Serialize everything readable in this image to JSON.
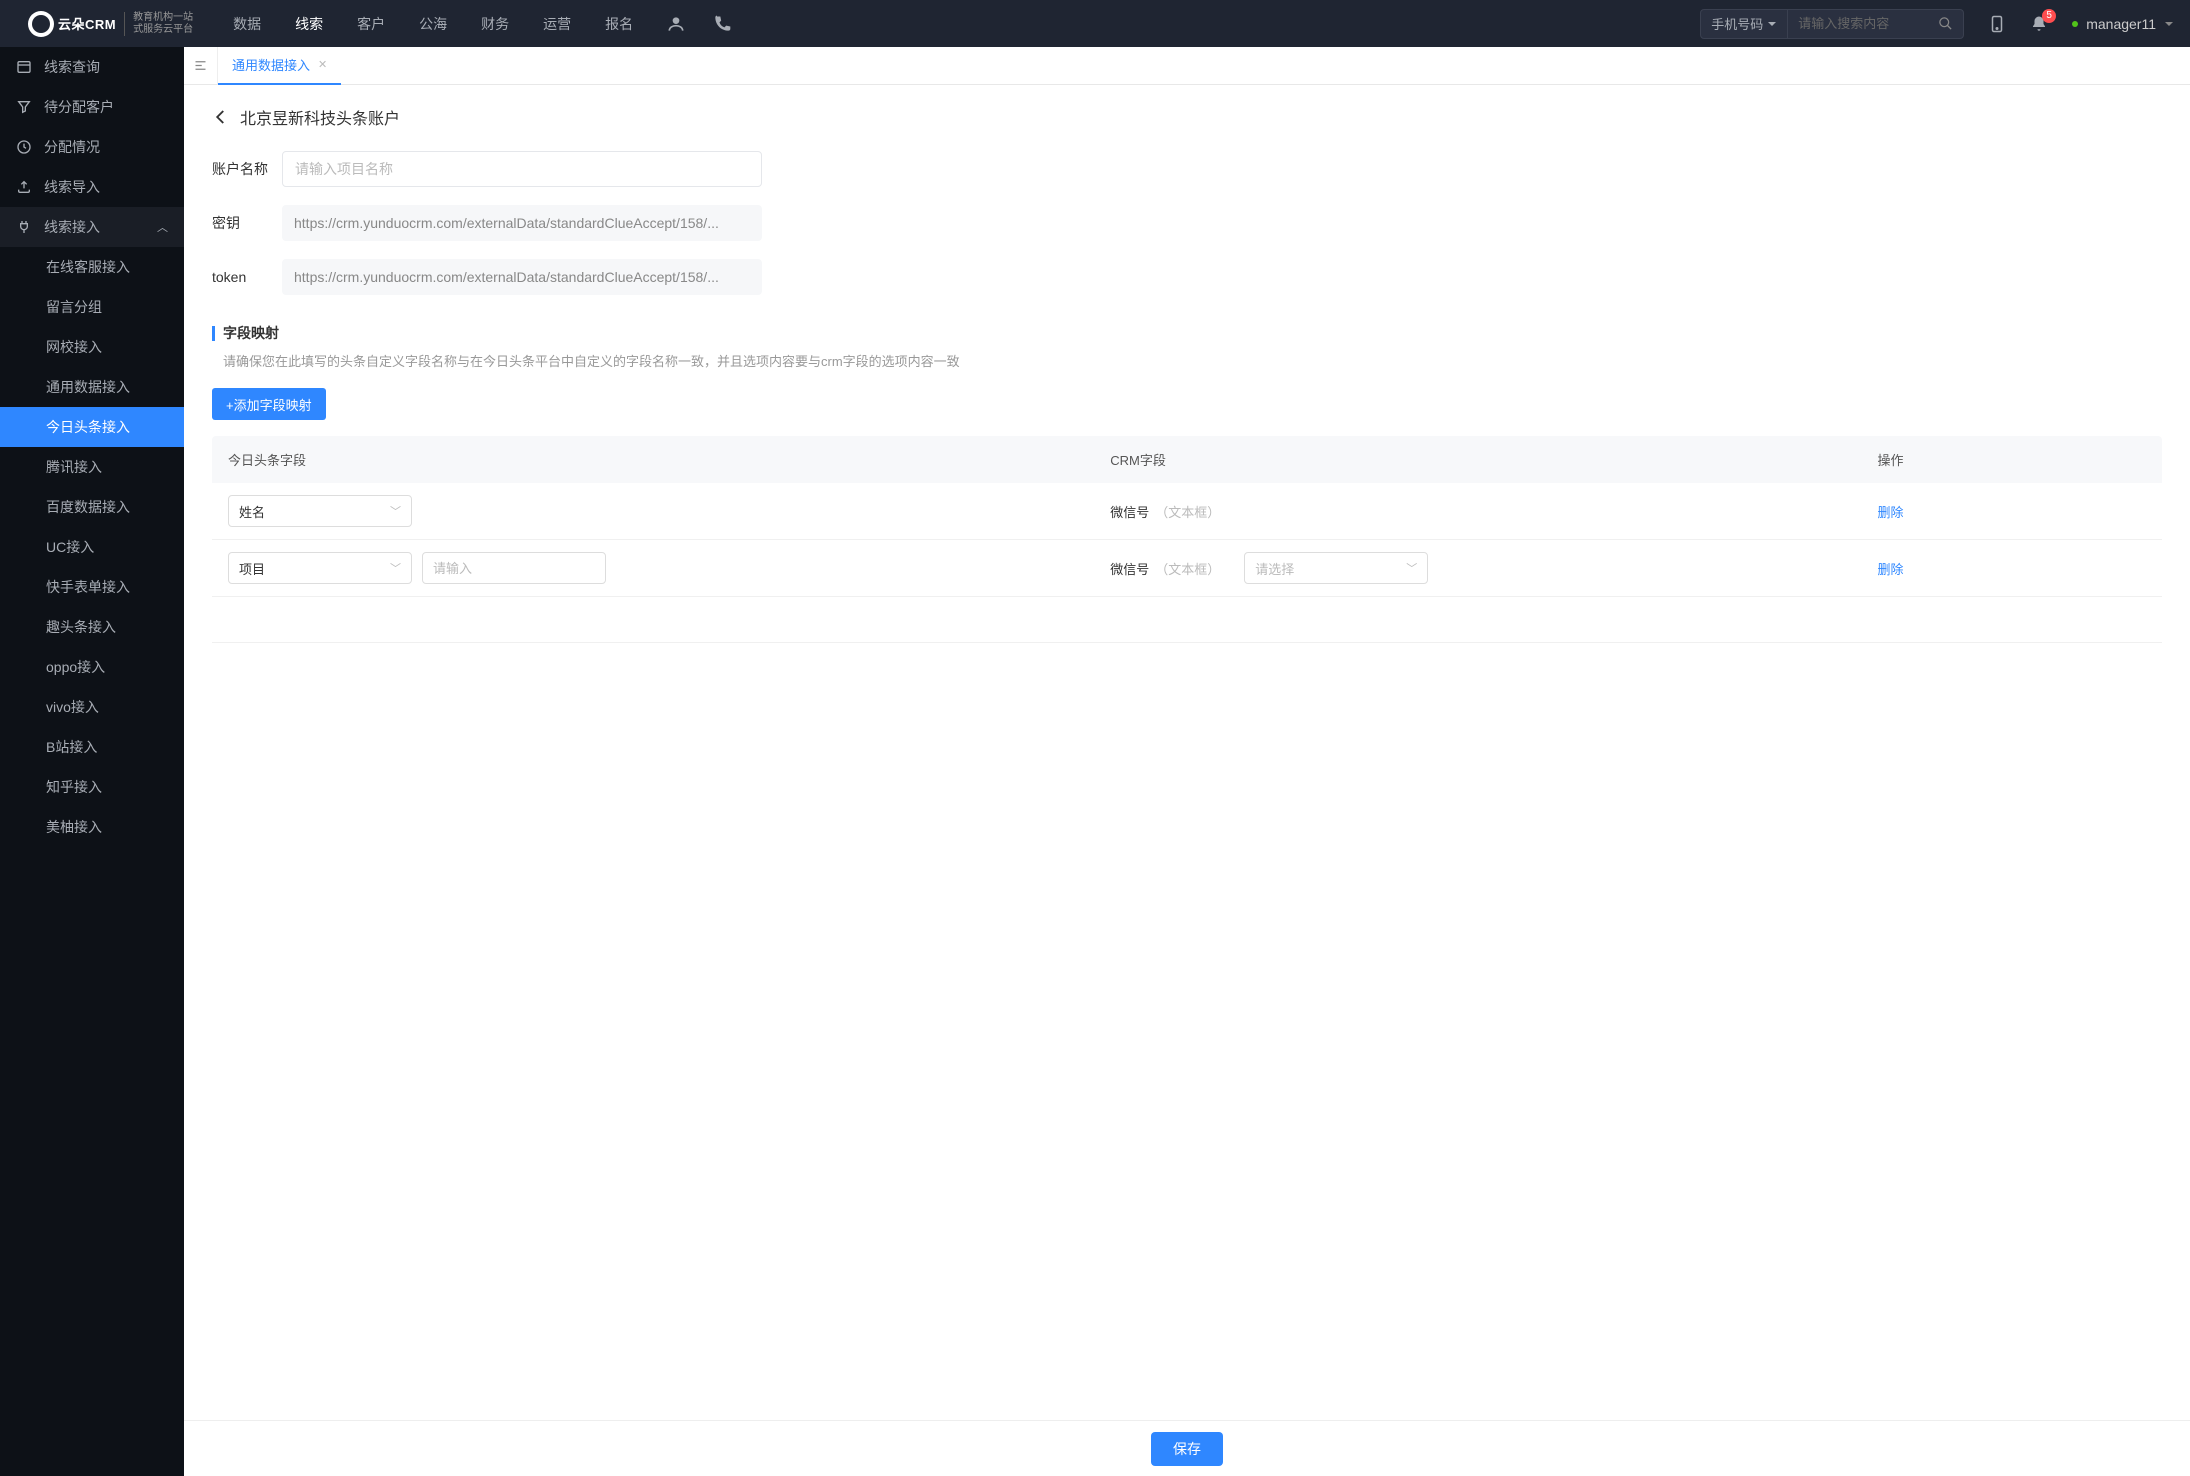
{
  "brand": {
    "name": "云朵CRM",
    "tagline_l1": "教育机构一站",
    "tagline_l2": "式服务云平台"
  },
  "topnav": {
    "items": [
      "数据",
      "线索",
      "客户",
      "公海",
      "财务",
      "运营",
      "报名"
    ],
    "active_index": 1
  },
  "search": {
    "filter_label": "手机号码",
    "placeholder": "请输入搜索内容"
  },
  "notifications": {
    "count": "5"
  },
  "user": {
    "name": "manager11"
  },
  "sidebar": {
    "items": [
      {
        "label": "线索查询",
        "icon": "list"
      },
      {
        "label": "待分配客户",
        "icon": "filter"
      },
      {
        "label": "分配情况",
        "icon": "clock"
      },
      {
        "label": "线索导入",
        "icon": "upload"
      },
      {
        "label": "线索接入",
        "icon": "plug",
        "expanded": true,
        "highlighted": true,
        "children": [
          {
            "label": "在线客服接入"
          },
          {
            "label": "留言分组"
          },
          {
            "label": "网校接入"
          },
          {
            "label": "通用数据接入"
          },
          {
            "label": "今日头条接入",
            "active": true
          },
          {
            "label": "腾讯接入"
          },
          {
            "label": "百度数据接入"
          },
          {
            "label": "UC接入"
          },
          {
            "label": "快手表单接入"
          },
          {
            "label": "趣头条接入"
          },
          {
            "label": "oppo接入"
          },
          {
            "label": "vivo接入"
          },
          {
            "label": "B站接入"
          },
          {
            "label": "知乎接入"
          },
          {
            "label": "美柚接入"
          }
        ]
      }
    ]
  },
  "tabs": [
    {
      "label": "通用数据接入",
      "active": true
    }
  ],
  "page": {
    "title": "北京昱新科技头条账户",
    "form": {
      "account_label": "账户名称",
      "account_placeholder": "请输入项目名称",
      "secret_label": "密钥",
      "secret_value": "https://crm.yunduocrm.com/externalData/standardClueAccept/158/...",
      "token_label": "token",
      "token_value": "https://crm.yunduocrm.com/externalData/standardClueAccept/158/..."
    },
    "mapping": {
      "section_title": "字段映射",
      "help_text": "请确保您在此填写的头条自定义字段名称与在今日头条平台中自定义的字段名称一致，并且选项内容要与crm字段的选项内容一致",
      "add_button": "+添加字段映射",
      "columns": {
        "toutiao": "今日头条字段",
        "crm": "CRM字段",
        "op": "操作"
      },
      "rows": [
        {
          "tt_value": "姓名",
          "crm_label": "微信号",
          "crm_hint": "（文本框）",
          "delete": "删除"
        },
        {
          "tt_value": "项目",
          "tt_extra_placeholder": "请输入",
          "crm_label": "微信号",
          "crm_hint": "（文本框）",
          "crm_select_placeholder": "请选择",
          "delete": "删除"
        }
      ]
    },
    "save_label": "保存"
  }
}
